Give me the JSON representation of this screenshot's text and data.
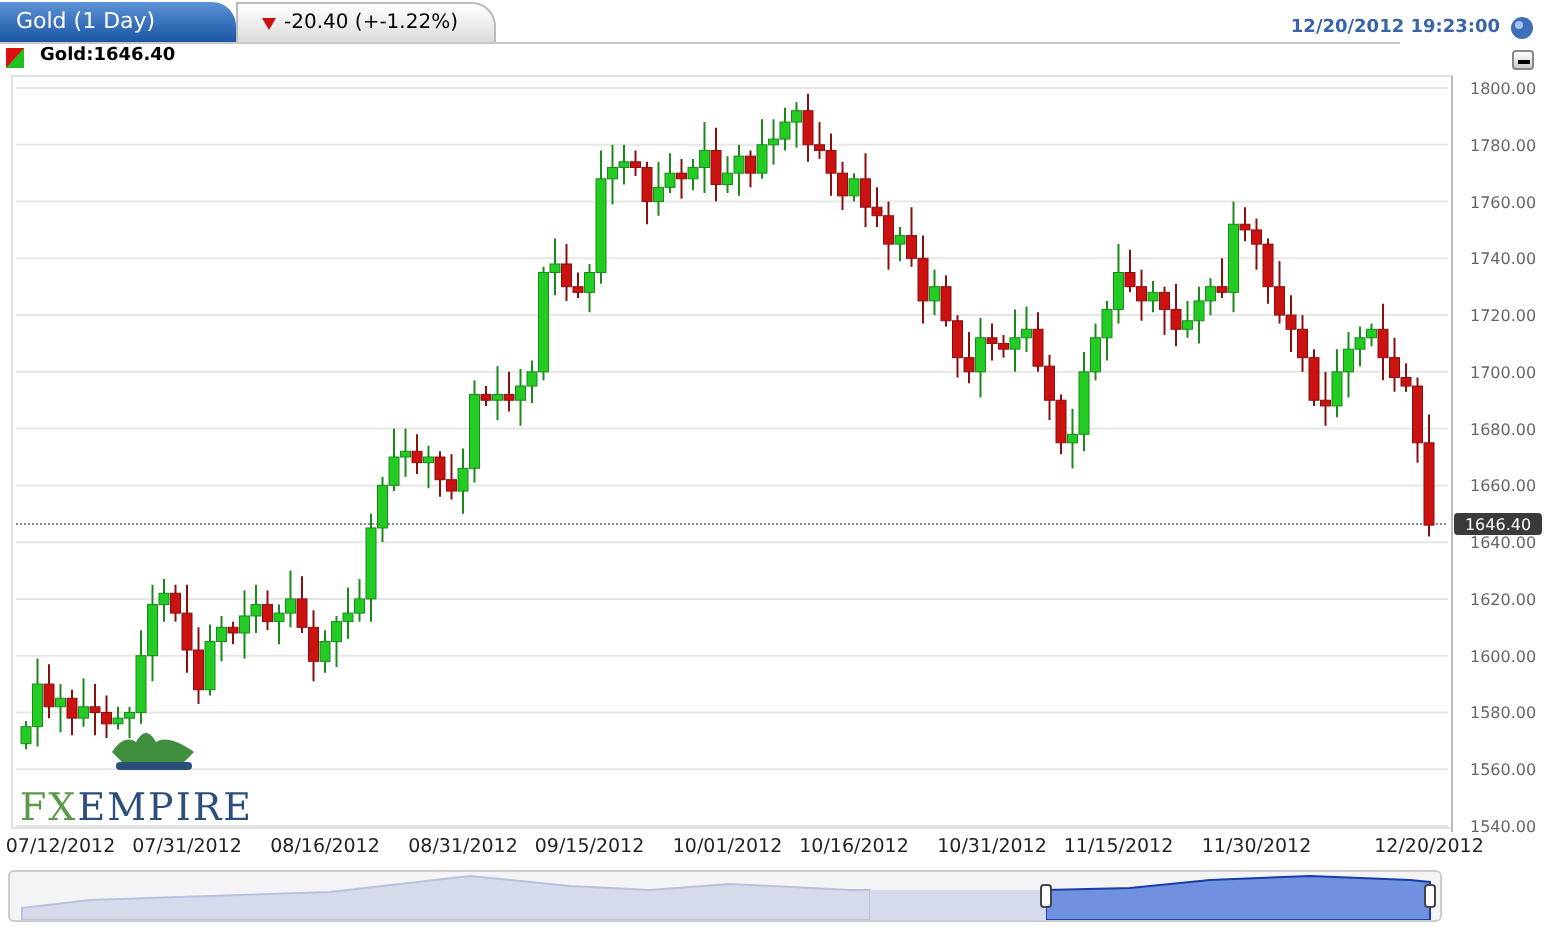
{
  "header": {
    "tabs": [
      {
        "label": "Gold (1 Day)",
        "selected": true
      },
      {
        "label": "-20.40 (+-1.22%)",
        "selected": false,
        "falling": true
      }
    ],
    "timestamp": "12/20/2012 19:23:00"
  },
  "legend": {
    "label": "Gold:1646.40"
  },
  "chart": {
    "chart_data": {
      "type": "candlestick",
      "grid": true,
      "ylim": [
        1540,
        1800
      ],
      "yticks": [
        {
          "value": 1540,
          "label": "1540.00"
        },
        {
          "value": 1560,
          "label": "1560.00"
        },
        {
          "value": 1580,
          "label": "1580.00"
        },
        {
          "value": 1600,
          "label": "1600.00"
        },
        {
          "value": 1620,
          "label": "1620.00"
        },
        {
          "value": 1640,
          "label": "1640.00"
        },
        {
          "value": 1660,
          "label": "1660.00"
        },
        {
          "value": 1680,
          "label": "1680.00"
        },
        {
          "value": 1700,
          "label": "1700.00"
        },
        {
          "value": 1720,
          "label": "1720.00"
        },
        {
          "value": 1740,
          "label": "1740.00"
        },
        {
          "value": 1760,
          "label": "1760.00"
        },
        {
          "value": 1780,
          "label": "1780.00"
        },
        {
          "value": 1800,
          "label": "1800.00"
        }
      ],
      "ref_lines": [
        {
          "axis": "y",
          "value": 1646.4,
          "label": "1646.40"
        }
      ],
      "categories": [
        null,
        null,
        null,
        "07/12/2012",
        null,
        null,
        null,
        null,
        null,
        null,
        null,
        null,
        null,
        null,
        "07/31/2012",
        null,
        null,
        null,
        null,
        null,
        null,
        null,
        null,
        null,
        null,
        null,
        "08/16/2012",
        null,
        null,
        null,
        null,
        null,
        null,
        null,
        null,
        null,
        null,
        null,
        "08/31/2012",
        null,
        null,
        null,
        null,
        null,
        null,
        null,
        null,
        null,
        null,
        "09/15/2012",
        null,
        null,
        null,
        null,
        null,
        null,
        null,
        null,
        null,
        null,
        null,
        "10/01/2012",
        null,
        null,
        null,
        null,
        null,
        null,
        null,
        null,
        null,
        null,
        "10/16/2012",
        null,
        null,
        null,
        null,
        null,
        null,
        null,
        null,
        null,
        null,
        null,
        "10/31/2012",
        null,
        null,
        null,
        null,
        null,
        null,
        null,
        null,
        null,
        null,
        "11/15/2012",
        null,
        null,
        null,
        null,
        null,
        null,
        null,
        null,
        null,
        null,
        null,
        "11/30/2012",
        null,
        null,
        null,
        null,
        null,
        null,
        null,
        null,
        null,
        null,
        null,
        null,
        null,
        null,
        "12/20/2012"
      ],
      "ohlc": [
        [
          1569,
          1577,
          1567,
          1575
        ],
        [
          1575,
          1599,
          1568,
          1590
        ],
        [
          1590,
          1597,
          1578,
          1582
        ],
        [
          1582,
          1590,
          1573,
          1585
        ],
        [
          1585,
          1588,
          1572,
          1578
        ],
        [
          1578,
          1592,
          1575,
          1582
        ],
        [
          1582,
          1590,
          1572,
          1580
        ],
        [
          1580,
          1586,
          1571,
          1576
        ],
        [
          1576,
          1582,
          1574,
          1578
        ],
        [
          1578,
          1582,
          1571,
          1580
        ],
        [
          1580,
          1609,
          1576,
          1600
        ],
        [
          1600,
          1625,
          1591,
          1618
        ],
        [
          1618,
          1627,
          1612,
          1622
        ],
        [
          1622,
          1625,
          1612,
          1615
        ],
        [
          1615,
          1625,
          1594,
          1602
        ],
        [
          1602,
          1610,
          1583,
          1588
        ],
        [
          1588,
          1611,
          1586,
          1605
        ],
        [
          1605,
          1614,
          1598,
          1610
        ],
        [
          1610,
          1612,
          1604,
          1608
        ],
        [
          1608,
          1623,
          1599,
          1614
        ],
        [
          1614,
          1625,
          1608,
          1618
        ],
        [
          1618,
          1623,
          1609,
          1612
        ],
        [
          1612,
          1618,
          1604,
          1615
        ],
        [
          1615,
          1630,
          1610,
          1620
        ],
        [
          1620,
          1628,
          1608,
          1610
        ],
        [
          1610,
          1616,
          1591,
          1598
        ],
        [
          1598,
          1609,
          1594,
          1605
        ],
        [
          1605,
          1614,
          1596,
          1612
        ],
        [
          1612,
          1624,
          1606,
          1615
        ],
        [
          1615,
          1627,
          1612,
          1620
        ],
        [
          1620,
          1650,
          1612,
          1645
        ],
        [
          1645,
          1663,
          1640,
          1660
        ],
        [
          1660,
          1680,
          1658,
          1670
        ],
        [
          1670,
          1680,
          1663,
          1672
        ],
        [
          1672,
          1678,
          1664,
          1668
        ],
        [
          1668,
          1674,
          1659,
          1670
        ],
        [
          1670,
          1672,
          1656,
          1662
        ],
        [
          1662,
          1671,
          1655,
          1658
        ],
        [
          1658,
          1673,
          1650,
          1666
        ],
        [
          1666,
          1697,
          1661,
          1692
        ],
        [
          1692,
          1695,
          1688,
          1690
        ],
        [
          1690,
          1702,
          1683,
          1692
        ],
        [
          1692,
          1700,
          1686,
          1690
        ],
        [
          1690,
          1701,
          1681,
          1695
        ],
        [
          1695,
          1704,
          1689,
          1700
        ],
        [
          1700,
          1737,
          1697,
          1735
        ],
        [
          1735,
          1747,
          1727,
          1738
        ],
        [
          1738,
          1745,
          1725,
          1730
        ],
        [
          1730,
          1735,
          1726,
          1728
        ],
        [
          1728,
          1738,
          1721,
          1735
        ],
        [
          1735,
          1778,
          1731,
          1768
        ],
        [
          1768,
          1780,
          1759,
          1772
        ],
        [
          1772,
          1780,
          1766,
          1774
        ],
        [
          1774,
          1778,
          1769,
          1772
        ],
        [
          1772,
          1774,
          1752,
          1760
        ],
        [
          1760,
          1774,
          1755,
          1765
        ],
        [
          1765,
          1777,
          1763,
          1770
        ],
        [
          1770,
          1775,
          1761,
          1768
        ],
        [
          1768,
          1775,
          1764,
          1772
        ],
        [
          1772,
          1788,
          1763,
          1778
        ],
        [
          1778,
          1786,
          1760,
          1766
        ],
        [
          1766,
          1776,
          1763,
          1770
        ],
        [
          1770,
          1780,
          1762,
          1776
        ],
        [
          1776,
          1778,
          1765,
          1770
        ],
        [
          1770,
          1789,
          1768,
          1780
        ],
        [
          1780,
          1789,
          1773,
          1782
        ],
        [
          1782,
          1793,
          1778,
          1788
        ],
        [
          1788,
          1795,
          1779,
          1792
        ],
        [
          1792,
          1798,
          1774,
          1780
        ],
        [
          1780,
          1788,
          1775,
          1778
        ],
        [
          1778,
          1784,
          1762,
          1770
        ],
        [
          1770,
          1774,
          1757,
          1762
        ],
        [
          1762,
          1770,
          1760,
          1768
        ],
        [
          1768,
          1777,
          1751,
          1758
        ],
        [
          1758,
          1765,
          1751,
          1755
        ],
        [
          1755,
          1760,
          1736,
          1745
        ],
        [
          1745,
          1751,
          1739,
          1748
        ],
        [
          1748,
          1758,
          1737,
          1740
        ],
        [
          1740,
          1748,
          1717,
          1725
        ],
        [
          1725,
          1736,
          1720,
          1730
        ],
        [
          1730,
          1734,
          1716,
          1718
        ],
        [
          1718,
          1720,
          1698,
          1705
        ],
        [
          1705,
          1714,
          1696,
          1700
        ],
        [
          1700,
          1719,
          1691,
          1712
        ],
        [
          1712,
          1717,
          1704,
          1710
        ],
        [
          1710,
          1713,
          1705,
          1708
        ],
        [
          1708,
          1722,
          1700,
          1712
        ],
        [
          1712,
          1723,
          1707,
          1715
        ],
        [
          1715,
          1721,
          1700,
          1702
        ],
        [
          1702,
          1706,
          1683,
          1690
        ],
        [
          1690,
          1692,
          1671,
          1675
        ],
        [
          1675,
          1687,
          1666,
          1678
        ],
        [
          1678,
          1707,
          1672,
          1700
        ],
        [
          1700,
          1717,
          1697,
          1712
        ],
        [
          1712,
          1725,
          1704,
          1722
        ],
        [
          1722,
          1745,
          1717,
          1735
        ],
        [
          1735,
          1743,
          1728,
          1730
        ],
        [
          1730,
          1736,
          1718,
          1725
        ],
        [
          1725,
          1732,
          1721,
          1728
        ],
        [
          1728,
          1730,
          1713,
          1722
        ],
        [
          1722,
          1731,
          1709,
          1715
        ],
        [
          1715,
          1725,
          1712,
          1718
        ],
        [
          1718,
          1730,
          1710,
          1725
        ],
        [
          1725,
          1733,
          1720,
          1730
        ],
        [
          1730,
          1740,
          1726,
          1728
        ],
        [
          1728,
          1760,
          1721,
          1752
        ],
        [
          1752,
          1758,
          1746,
          1750
        ],
        [
          1750,
          1754,
          1736,
          1745
        ],
        [
          1745,
          1747,
          1724,
          1730
        ],
        [
          1730,
          1739,
          1717,
          1720
        ],
        [
          1720,
          1727,
          1707,
          1715
        ],
        [
          1715,
          1720,
          1700,
          1705
        ],
        [
          1705,
          1708,
          1688,
          1690
        ],
        [
          1690,
          1700,
          1681,
          1688
        ],
        [
          1688,
          1708,
          1684,
          1700
        ],
        [
          1700,
          1714,
          1691,
          1708
        ],
        [
          1708,
          1716,
          1702,
          1712
        ],
        [
          1712,
          1717,
          1709,
          1715
        ],
        [
          1715,
          1724,
          1697,
          1705
        ],
        [
          1705,
          1712,
          1693,
          1698
        ],
        [
          1698,
          1703,
          1693,
          1695
        ],
        [
          1695,
          1698,
          1668,
          1675
        ],
        [
          1675,
          1685,
          1642,
          1646
        ]
      ]
    }
  },
  "logo": {
    "parts": [
      "FX",
      "EMPIRE"
    ]
  }
}
